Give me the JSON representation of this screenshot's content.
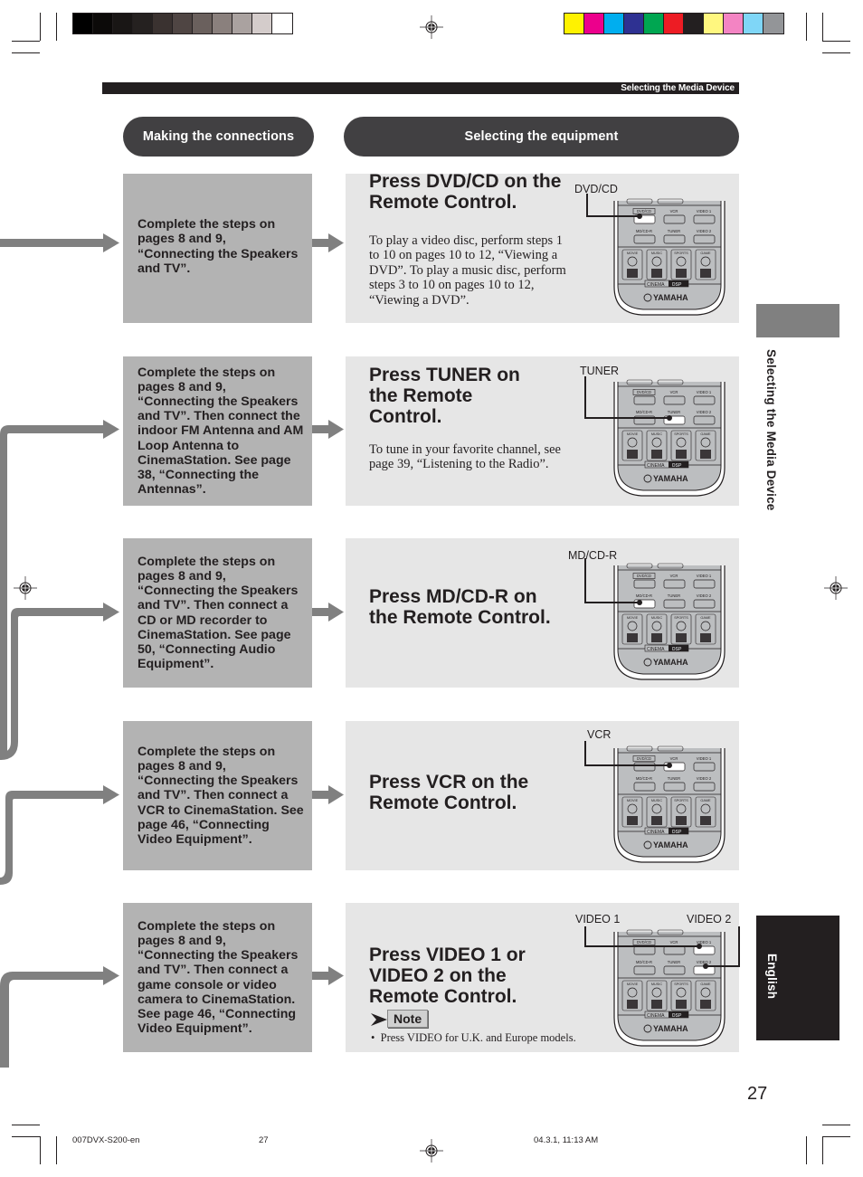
{
  "header": {
    "section_title": "Selecting the Media Device"
  },
  "columns": {
    "left_pill": "Making the connections",
    "right_pill": "Selecting the equipment"
  },
  "colors": {
    "dark_pill": "#414042",
    "left_box": "#b3b3b3",
    "right_box": "#e6e6e6",
    "arrow": "#808080",
    "tab_gray": "#808080",
    "tab_dark": "#231f20"
  },
  "rows": [
    {
      "connection_text": "Complete the steps on pages 8 and 9, “Connecting the Speakers and TV”.",
      "heading": "Press DVD/CD on the Remote Control.",
      "body": "To play a video disc, perform steps 1 to 10 on pages 10 to 12, “Viewing a DVD”. To play a music disc, perform steps 3 to 10 on pages 10 to 12, “Viewing a DVD”.",
      "callouts": [
        "DVD/CD"
      ],
      "highlighted_button": "DVD/CD"
    },
    {
      "connection_text": "Complete the steps on pages 8 and 9, “Connecting the Speakers and TV”. Then connect the indoor FM Antenna and AM Loop Antenna to CinemaStation. See page 38, “Connecting the Antennas”.",
      "heading": "Press TUNER on the Remote Control.",
      "body": "To tune in your favorite channel, see page 39, “Listening to the Radio”.",
      "callouts": [
        "TUNER"
      ],
      "highlighted_button": "TUNER"
    },
    {
      "connection_text": "Complete the steps on pages 8 and 9, “Connecting the Speakers and TV”. Then connect a CD or MD recorder to CinemaStation. See page 50, “Connecting Audio Equipment”.",
      "heading": "Press MD/CD-R on the Remote Control.",
      "body": "",
      "callouts": [
        "MD/CD-R"
      ],
      "highlighted_button": "MD/CD-R"
    },
    {
      "connection_text": "Complete the steps on pages 8 and 9, “Connecting the Speakers and TV”. Then connect a VCR to CinemaStation. See page 46, “Connecting Video Equipment”.",
      "heading": "Press VCR on the Remote Control.",
      "body": "",
      "callouts": [
        "VCR"
      ],
      "highlighted_button": "VCR"
    },
    {
      "connection_text": "Complete the steps on pages 8 and 9, “Connecting the Speakers and TV”. Then connect a game console or video camera to CinemaStation. See page 46, “Connecting Video Equipment”.",
      "heading": "Press VIDEO 1 or VIDEO 2 on the Remote Control.",
      "body": "",
      "callouts": [
        "VIDEO 1",
        "VIDEO 2"
      ],
      "highlighted_button": "VIDEO 1 / VIDEO 2",
      "note_label": "Note",
      "note_text": "Press VIDEO for U.K. and Europe models."
    }
  ],
  "remote": {
    "row1": [
      "DVD/CD",
      "VCR",
      "VIDEO 1"
    ],
    "row2": [
      "MD/CD-R",
      "TUNER",
      "VIDEO 2"
    ],
    "modes": [
      "MOVIE",
      "MUSIC",
      "SPORTS",
      "GAME"
    ],
    "dsp_label": "CINEMA DSP",
    "brand": "YAMAHA"
  },
  "side_tabs": {
    "section": "Selecting the Media Device",
    "language": "English"
  },
  "page_number": "27",
  "footer": {
    "file": "007DVX-S200-en",
    "page": "27",
    "timestamp": "04.3.1, 11:13 AM"
  },
  "color_bars": {
    "grayscale": [
      "#000000",
      "#0c0a09",
      "#191615",
      "#252120",
      "#3a3230",
      "#4f4543",
      "#6a605d",
      "#8a807d",
      "#aaa2a0",
      "#d4cccb",
      "#ffffff"
    ],
    "process": [
      "#fff200",
      "#ec008c",
      "#00aeef",
      "#2e3192",
      "#00a651",
      "#ed1c24",
      "#231f20",
      "#fff77f",
      "#f384c3",
      "#7fd6f7",
      "#939598"
    ]
  }
}
